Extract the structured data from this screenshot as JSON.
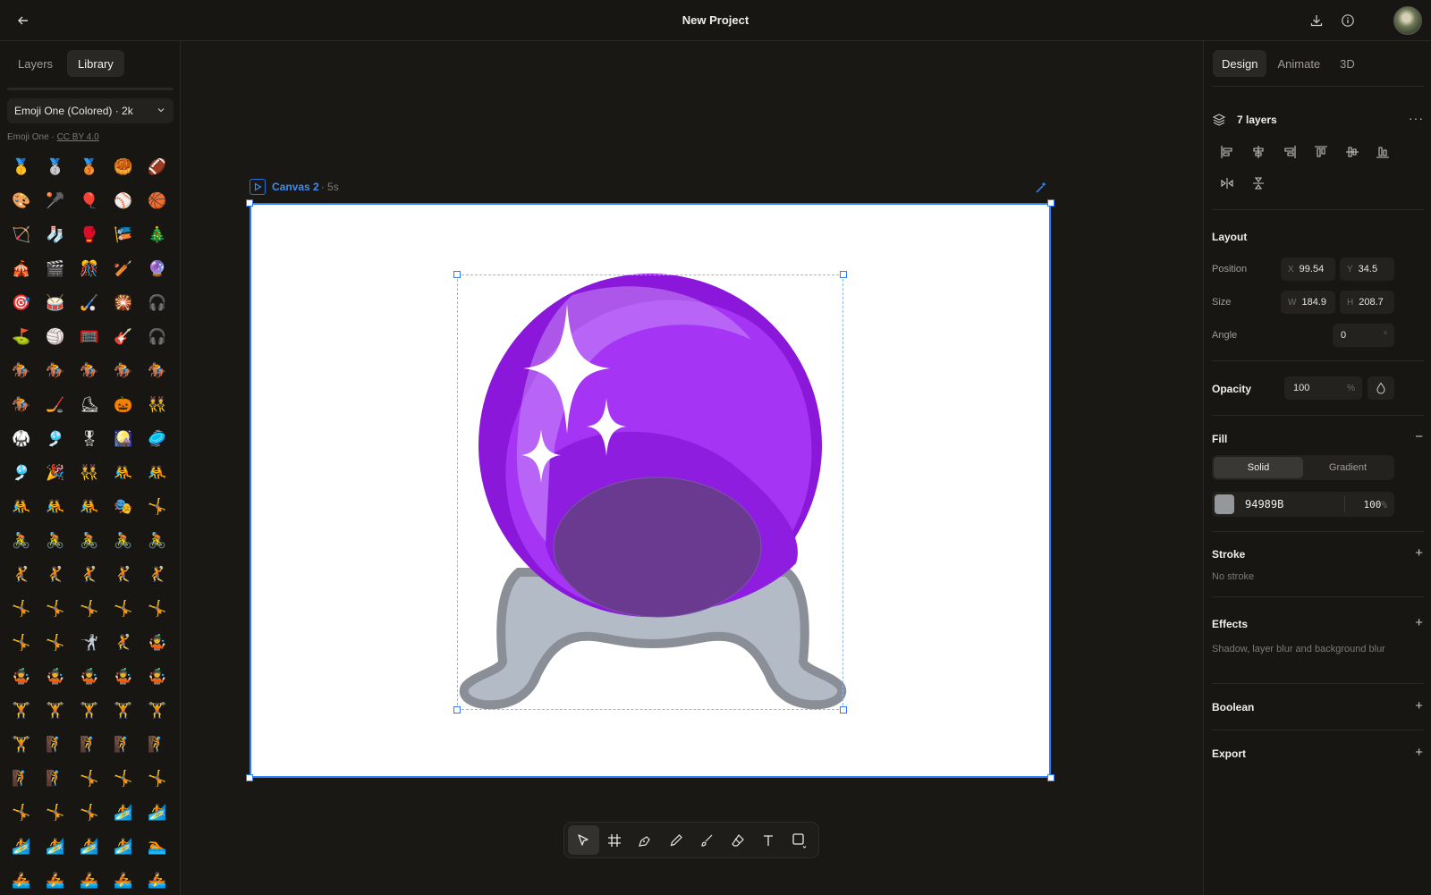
{
  "header": {
    "title": "New Project",
    "back_icon": "arrow-left-icon",
    "actions": [
      "download-icon",
      "info-icon",
      "avatar"
    ]
  },
  "left_panel": {
    "tabs": [
      {
        "label": "Layers",
        "active": false
      },
      {
        "label": "Library",
        "active": true
      }
    ],
    "library_select": "Emoji One (Colored) · 2k",
    "credit_prefix": "Emoji One · ",
    "credit_license": "CC BY 4.0",
    "emojis": [
      "🥇",
      "🥈",
      "🥉",
      "🥮",
      "🏈",
      "🎨",
      "🥍",
      "🎈",
      "⚾",
      "🏀",
      "🏹",
      "🧦",
      "🥊",
      "🎏",
      "🎄",
      "🎪",
      "🎬",
      "🎊",
      "🏏",
      "🔮",
      "🎯",
      "🥁",
      "🏑",
      "🎇",
      "🎧",
      "⛳",
      "🏐",
      "🥅",
      "🎸",
      "🎧",
      "🏇",
      "🏇",
      "🏇",
      "🏇",
      "🏇",
      "🏇",
      "🏒",
      "⛸",
      "🎃",
      "👯",
      "🥋",
      "🎐",
      "🎖",
      "🎑",
      "🥏",
      "🎐",
      "🎉",
      "👯",
      "🤼",
      "🤼",
      "🤼",
      "🤼",
      "🤼",
      "🎭",
      "🤸",
      "🚴",
      "🚴",
      "🚴",
      "🚴",
      "🚴",
      "🤾",
      "🤾",
      "🤾",
      "🤾",
      "🤾",
      "🤸",
      "🤸",
      "🤸",
      "🤸",
      "🤸",
      "🤸",
      "🤸",
      "🤺",
      "🤾",
      "🤹",
      "🤹",
      "🤹",
      "🤹",
      "🤹",
      "🤹",
      "🏋",
      "🏋",
      "🏋",
      "🏋",
      "🏋",
      "🏋",
      "🧗",
      "🧗",
      "🧗",
      "🧗",
      "🧗",
      "🧗",
      "🤸",
      "🤸",
      "🤸",
      "🤸",
      "🤸",
      "🤸",
      "🏄",
      "🏄",
      "🏄",
      "🏄",
      "🏄",
      "🏄",
      "🏊",
      "🚣",
      "🚣",
      "🚣",
      "🚣",
      "🚣"
    ]
  },
  "canvas": {
    "name": "Canvas 2",
    "duration": " · 5s",
    "art_colors": {
      "orb_outer": "#8a17d9",
      "orb_inner": "#a534f4",
      "orb_shade": "#8e1de0",
      "orb_bottom": "#6a3a91",
      "stand_fill": "#b3bbc6",
      "stand_stroke": "#8a8f97"
    }
  },
  "right_panel": {
    "tabs": [
      {
        "label": "Design",
        "active": true
      },
      {
        "label": "Animate",
        "active": false
      },
      {
        "label": "3D",
        "active": false
      }
    ],
    "layers_count": "7 layers",
    "layout": {
      "title": "Layout",
      "position_label": "Position",
      "x_prefix": "X",
      "x_value": "99.54",
      "y_prefix": "Y",
      "y_value": "34.5",
      "size_label": "Size",
      "w_prefix": "W",
      "w_value": "184.9",
      "h_prefix": "H",
      "h_value": "208.7",
      "angle_label": "Angle",
      "angle_value": "0",
      "angle_unit": "°"
    },
    "opacity": {
      "label": "Opacity",
      "value": "100",
      "unit": "%"
    },
    "fill": {
      "title": "Fill",
      "modes": [
        "Solid",
        "Gradient"
      ],
      "active_mode": "Solid",
      "color_hex": "94989B",
      "swatch": "#94989b",
      "alpha": "100",
      "alpha_unit": "%"
    },
    "stroke": {
      "title": "Stroke",
      "empty": "No stroke"
    },
    "effects": {
      "title": "Effects",
      "desc": "Shadow, layer blur and background blur"
    },
    "boolean": {
      "title": "Boolean"
    },
    "export": {
      "title": "Export"
    }
  },
  "toolbar": {
    "tools": [
      "select-icon",
      "frame-icon",
      "pen-icon",
      "pencil-icon",
      "brush-icon",
      "eraser-icon",
      "text-icon",
      "shape-icon"
    ],
    "active": "select-icon"
  },
  "colors": {
    "accent": "#2e7cf6",
    "panel": "#171613",
    "stage": "#1a1814"
  }
}
